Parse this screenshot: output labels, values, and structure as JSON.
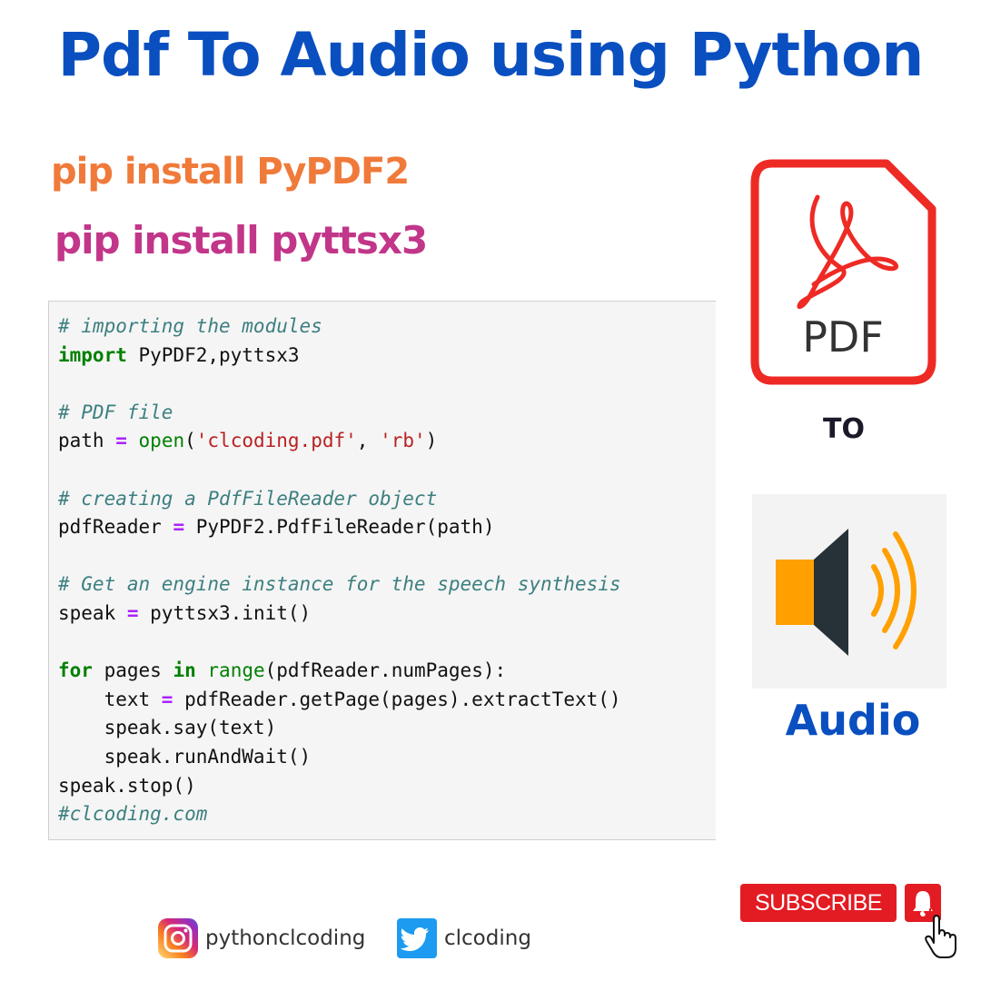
{
  "title": "Pdf To Audio using Python",
  "install": [
    "pip install PyPDF2",
    "pip install pyttsx3"
  ],
  "code": {
    "lines": [
      [
        {
          "t": "# importing the modules",
          "c": "comment"
        }
      ],
      [
        {
          "t": "import",
          "c": "kw"
        },
        {
          "t": " PyPDF2,pyttsx3",
          "c": "plain"
        }
      ],
      [],
      [
        {
          "t": "# PDF file",
          "c": "comment"
        }
      ],
      [
        {
          "t": "path ",
          "c": "plain"
        },
        {
          "t": "=",
          "c": "op"
        },
        {
          "t": " ",
          "c": "plain"
        },
        {
          "t": "open",
          "c": "builtin"
        },
        {
          "t": "(",
          "c": "plain"
        },
        {
          "t": "'clcoding.pdf'",
          "c": "str"
        },
        {
          "t": ", ",
          "c": "plain"
        },
        {
          "t": "'rb'",
          "c": "str"
        },
        {
          "t": ")",
          "c": "plain"
        }
      ],
      [],
      [
        {
          "t": "# creating a PdfFileReader object",
          "c": "comment"
        }
      ],
      [
        {
          "t": "pdfReader ",
          "c": "plain"
        },
        {
          "t": "=",
          "c": "op"
        },
        {
          "t": " PyPDF2.PdfFileReader(path)",
          "c": "plain"
        }
      ],
      [],
      [
        {
          "t": "# Get an engine instance for the speech synthesis",
          "c": "comment"
        }
      ],
      [
        {
          "t": "speak ",
          "c": "plain"
        },
        {
          "t": "=",
          "c": "op"
        },
        {
          "t": " pyttsx3.init()",
          "c": "plain"
        }
      ],
      [],
      [
        {
          "t": "for",
          "c": "kw"
        },
        {
          "t": " pages ",
          "c": "plain"
        },
        {
          "t": "in",
          "c": "kw"
        },
        {
          "t": " ",
          "c": "plain"
        },
        {
          "t": "range",
          "c": "builtin"
        },
        {
          "t": "(pdfReader.numPages):",
          "c": "plain"
        }
      ],
      [
        {
          "t": "    text ",
          "c": "plain"
        },
        {
          "t": "=",
          "c": "op"
        },
        {
          "t": " pdfReader.getPage(pages).extractText()",
          "c": "plain"
        }
      ],
      [
        {
          "t": "    speak.say(text)",
          "c": "plain"
        }
      ],
      [
        {
          "t": "    speak.runAndWait()",
          "c": "plain"
        }
      ],
      [
        {
          "t": "speak.stop()",
          "c": "plain"
        }
      ],
      [
        {
          "t": "#clcoding.com",
          "c": "comment"
        }
      ]
    ]
  },
  "pdf_icon": {
    "label": "PDF",
    "icon": "pdf-file-icon",
    "color": "#ee2a24"
  },
  "to_label": "TO",
  "speaker": {
    "icon": "speaker-icon"
  },
  "audio_label": "Audio",
  "subscribe": {
    "label": "SUBSCRIBE",
    "color": "#e31b23"
  },
  "social": [
    {
      "icon": "instagram-icon",
      "handle": "pythonclcoding"
    },
    {
      "icon": "twitter-icon",
      "handle": "clcoding"
    }
  ],
  "colors": {
    "title": "#0a4fc0",
    "pip1": "#f07a3a",
    "pip2": "#c2368a",
    "audio": "#0a4fc0",
    "speaker_body": "#263238",
    "speaker_accent": "#ffa000"
  }
}
